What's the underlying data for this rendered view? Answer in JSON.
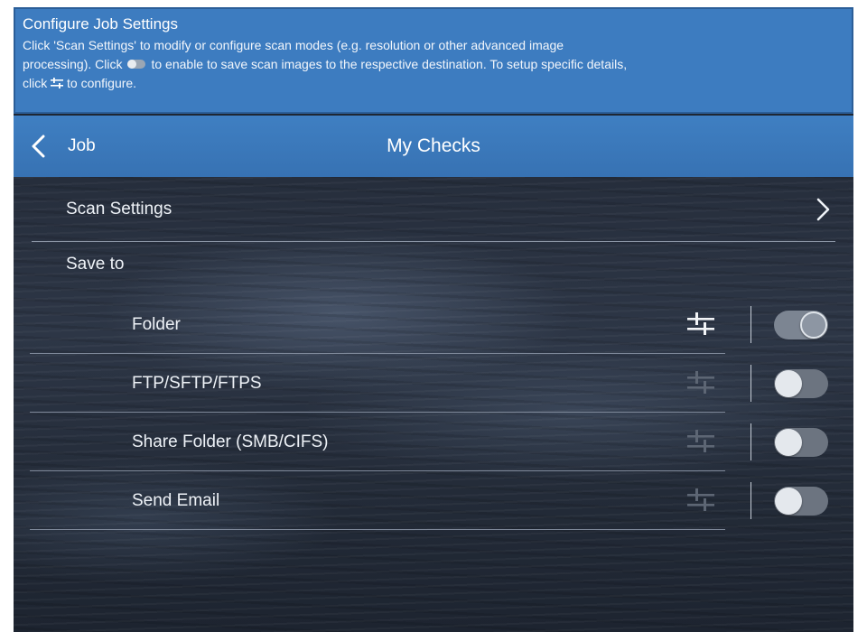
{
  "banner": {
    "title": "Configure Job Settings",
    "line1": "Click 'Scan Settings' to modify or configure scan modes (e.g. resolution or other advanced image",
    "line2_a": "processing).  Click",
    "line2_b": "to enable to save scan images to the respective destination. To setup specific details,",
    "line3_a": "click",
    "line3_b": "to configure."
  },
  "nav": {
    "back_label": "Job",
    "title": "My Checks"
  },
  "scan_settings": {
    "label": "Scan Settings"
  },
  "save_to": {
    "label": "Save to"
  },
  "destinations": [
    {
      "label": "Folder",
      "enabled": true
    },
    {
      "label": "FTP/SFTP/FTPS",
      "enabled": false
    },
    {
      "label": "Share Folder (SMB/CIFS)",
      "enabled": false
    },
    {
      "label": "Send Email",
      "enabled": false
    }
  ],
  "colors": {
    "banner": "#3d7cc0",
    "nav": "#3a76b8",
    "toggle_on": "#7c8592",
    "toggle_off": "#6c7480"
  },
  "icons": {
    "back": "chevron-left-icon",
    "forward": "chevron-right-icon",
    "configure": "sliders-icon",
    "toggle": "toggle-switch"
  }
}
